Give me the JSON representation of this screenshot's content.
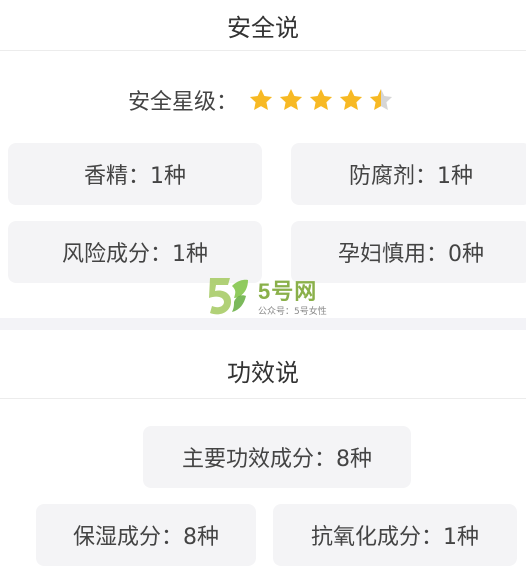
{
  "safety": {
    "title": "安全说",
    "rating": {
      "label": "安全星级：",
      "value": 4.5,
      "max": 5
    },
    "tags": [
      {
        "label": "香精：1种"
      },
      {
        "label": "防腐剂：1种"
      },
      {
        "label": "风险成分：1种"
      },
      {
        "label": "孕妇慎用：0种"
      }
    ]
  },
  "efficacy": {
    "title": "功效说",
    "tags": [
      {
        "label": "主要功效成分：8种"
      },
      {
        "label": "保湿成分：8种"
      },
      {
        "label": "抗氧化成分：1种"
      }
    ]
  },
  "watermark": {
    "name": "5号网",
    "subtitle": "公众号：5号女性"
  },
  "colors": {
    "star": "#f7b924",
    "star_empty": "#d6d6d6",
    "pill_bg": "#f4f4f6",
    "brand_green": "#8ab04a"
  }
}
